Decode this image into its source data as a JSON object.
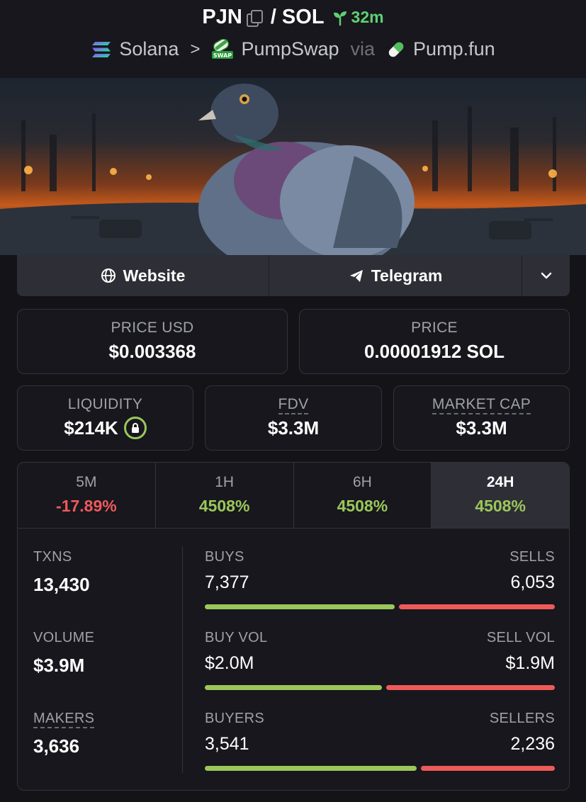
{
  "header": {
    "token": "PJN",
    "quote": "/ SOL",
    "age": "32m",
    "chain": "Solana",
    "separator": ">",
    "dex": "PumpSwap",
    "via": "via",
    "launchpad": "Pump.fun"
  },
  "links": {
    "website": "Website",
    "telegram": "Telegram"
  },
  "price": {
    "usd_label": "PRICE USD",
    "usd_value": "$0.003368",
    "native_label": "PRICE",
    "native_value": "0.00001912 SOL"
  },
  "metrics": {
    "liquidity_label": "LIQUIDITY",
    "liquidity_value": "$214K",
    "fdv_label": "FDV",
    "fdv_value": "$3.3M",
    "mcap_label": "MARKET CAP",
    "mcap_value": "$3.3M"
  },
  "timeframes": [
    {
      "label": "5M",
      "value": "-17.89%"
    },
    {
      "label": "1H",
      "value": "4508%"
    },
    {
      "label": "6H",
      "value": "4508%"
    },
    {
      "label": "24H",
      "value": "4508%"
    }
  ],
  "stats": {
    "txns_label": "TXNS",
    "txns_value": "13,430",
    "volume_label": "VOLUME",
    "volume_value": "$3.9M",
    "makers_label": "MAKERS",
    "makers_value": "3,636"
  },
  "breakdown": [
    {
      "left_label": "BUYS",
      "right_label": "SELLS",
      "left_value": "7,377",
      "right_value": "6,053",
      "buy_fraction": 0.549
    },
    {
      "left_label": "BUY VOL",
      "right_label": "SELL VOL",
      "left_value": "$2.0M",
      "right_value": "$1.9M",
      "buy_fraction": 0.513
    },
    {
      "left_label": "BUYERS",
      "right_label": "SELLERS",
      "left_value": "3,541",
      "right_value": "2,236",
      "buy_fraction": 0.613
    }
  ],
  "colors": {
    "positive": "#9bc75a",
    "negative": "#ee5a5a",
    "age": "#5fd073"
  }
}
